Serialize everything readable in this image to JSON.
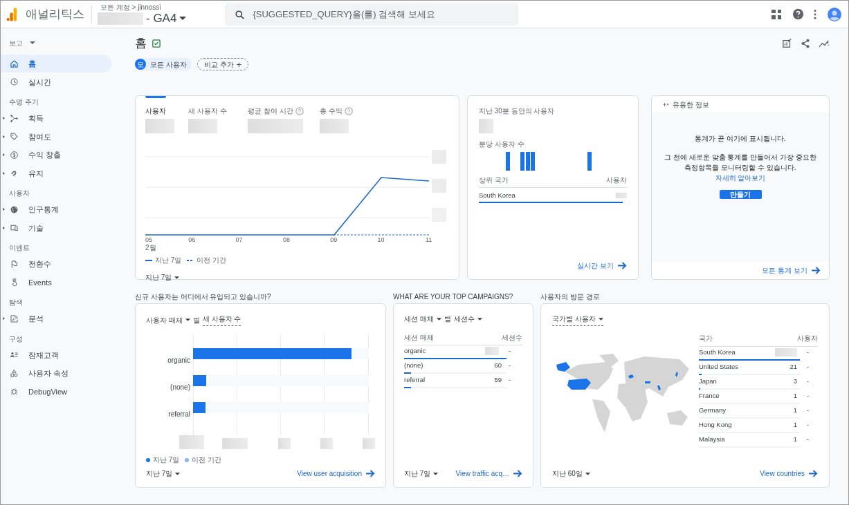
{
  "header": {
    "app_name": "애널리틱스",
    "breadcrumb": "모든 계정 > jinnossi",
    "property": "- GA4",
    "search_placeholder": "{SUGGESTED_QUERY}을(를) 검색해 보세요"
  },
  "sidebar": {
    "title": "보고",
    "groups": [
      {
        "items": [
          {
            "label": "홈",
            "expandable": false,
            "selected": true
          },
          {
            "label": "실시간",
            "expandable": false,
            "selected": false
          }
        ]
      },
      {
        "heading": "수명 주기",
        "items": [
          {
            "label": "획득",
            "expandable": true,
            "selected": false
          },
          {
            "label": "참여도",
            "expandable": true,
            "selected": false
          },
          {
            "label": "수익 창출",
            "expandable": true,
            "selected": false
          },
          {
            "label": "유지",
            "expandable": true,
            "selected": false
          }
        ]
      },
      {
        "heading": "사용자",
        "items": [
          {
            "label": "인구통계",
            "expandable": true,
            "selected": false
          },
          {
            "label": "기술",
            "expandable": true,
            "selected": false
          }
        ]
      },
      {
        "heading": "이벤트",
        "items": [
          {
            "label": "전환수",
            "expandable": false,
            "selected": false
          },
          {
            "label": "Events",
            "expandable": false,
            "selected": false
          }
        ]
      },
      {
        "heading": "탐색",
        "items": [
          {
            "label": "분석",
            "expandable": true,
            "selected": false
          }
        ]
      },
      {
        "heading": "구성",
        "items": [
          {
            "label": "잠재고객",
            "expandable": false,
            "selected": false
          },
          {
            "label": "사용자 속성",
            "expandable": false,
            "selected": false
          },
          {
            "label": "DebugView",
            "expandable": false,
            "selected": false
          }
        ]
      }
    ]
  },
  "page": {
    "title": "홈",
    "chip_avatar": "모",
    "comparison_chip": "모든 사용자",
    "add_comparison": "비교 추가",
    "add_symbol": "+"
  },
  "overview_card": {
    "metrics": [
      {
        "label": "사용자",
        "help": false,
        "selected": true
      },
      {
        "label": "새 사용자 수",
        "help": false,
        "selected": false
      },
      {
        "label": "평균 참여 시간",
        "help": true,
        "selected": false
      },
      {
        "label": "총 수익",
        "help": true,
        "selected": false
      }
    ],
    "x_labels": [
      "05",
      "06",
      "07",
      "08",
      "09",
      "10",
      "11"
    ],
    "month_label": "2월",
    "legend": [
      {
        "label": "지난 7일",
        "kind": "solid"
      },
      {
        "label": "이전 기간",
        "kind": "dashed"
      }
    ],
    "date_range": "지난 7일"
  },
  "realtime_card": {
    "title": "지난 30분 동안의 사용자",
    "per_minute": "분당 사용자 수",
    "columns": [
      "상위 국가",
      "사용자"
    ],
    "rows": [
      {
        "country": "South Korea",
        "level": 1
      }
    ],
    "link": "실시간 보기"
  },
  "insights_card": {
    "title": "유용한 정보",
    "message": "통계가 곧 여기에 표시됩니다.",
    "description": "그 전에 새로운 맞춤 통계를 만들어서 가장 중요한 측정항목을 모니터링할 수 있습니다.",
    "learn_more": "자세히 알아보기",
    "create_button": "만들기",
    "link": "모든 통계 보기"
  },
  "acquisition": {
    "heading": "신규 사용자는 어디에서 유입되고 있습니까?",
    "dimension": "사용자 매체",
    "by": "별",
    "metric": "새 사용자 수",
    "bars": [
      {
        "label": "organic",
        "level": 0.9
      },
      {
        "label": "(none)",
        "level": 0.075
      },
      {
        "label": "referral",
        "level": 0.07
      }
    ],
    "legend": [
      {
        "label": "지난 7일",
        "color": "#1a73e8"
      },
      {
        "label": "이전 기간",
        "color": "#8ab4f8"
      }
    ],
    "date_range": "지난 7일",
    "link": "View user acquisition"
  },
  "campaigns": {
    "heading": "WHAT ARE YOUR TOP CAMPAIGNS?",
    "dimension": "세션 매체",
    "by": "별",
    "metric": "세션수",
    "columns": [
      "세션 매체",
      "세션수"
    ],
    "rows": [
      {
        "medium": "organic",
        "change": "-",
        "level": 1
      },
      {
        "medium": "(none)",
        "value": "60",
        "change": "-",
        "level": 0.07
      },
      {
        "medium": "referral",
        "value": "59",
        "change": "-",
        "level": 0.07
      }
    ],
    "date_range": "지난 7일",
    "link": "View traffic acq…"
  },
  "countries": {
    "heading": "사용자의 방문 경로",
    "selector": "국가별 사용자",
    "columns": [
      "국가",
      "사용자"
    ],
    "rows": [
      {
        "country": "South Korea",
        "change": "-",
        "level": 1
      },
      {
        "country": "United States",
        "value": "21",
        "change": "-",
        "level": 0.03
      },
      {
        "country": "Japan",
        "value": "3",
        "change": "-",
        "level": 0.01
      },
      {
        "country": "France",
        "value": "1",
        "change": "-"
      },
      {
        "country": "Germany",
        "value": "1",
        "change": "-"
      },
      {
        "country": "Hong Kong",
        "value": "1",
        "change": "-"
      },
      {
        "country": "Malaysia",
        "value": "1",
        "change": "-"
      }
    ],
    "date_range": "지난 60일",
    "link": "View countries"
  }
}
